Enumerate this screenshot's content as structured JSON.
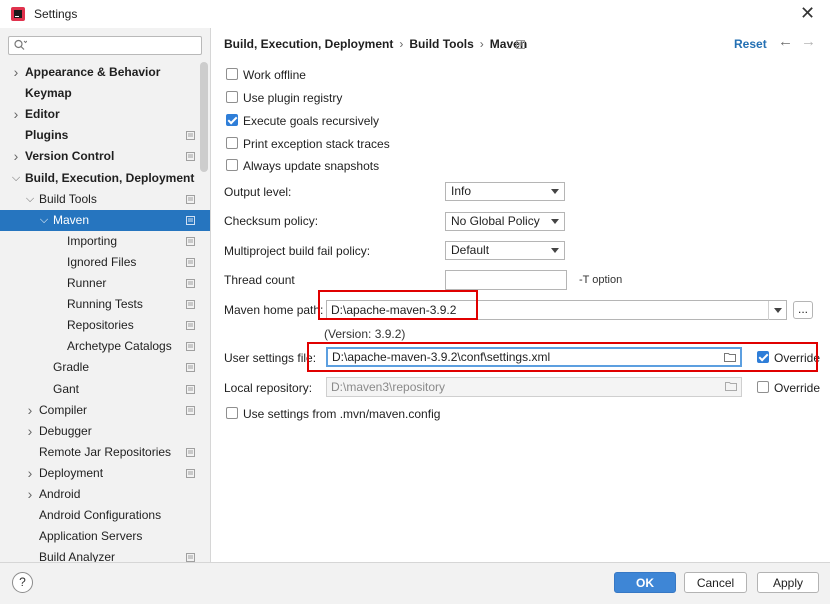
{
  "window": {
    "title": "Settings"
  },
  "search": {
    "placeholder": ""
  },
  "sidebar": {
    "items": [
      {
        "label": "Appearance & Behavior",
        "arrow": ">",
        "bold": true
      },
      {
        "label": "Keymap",
        "arrow": "",
        "bold": true
      },
      {
        "label": "Editor",
        "arrow": ">",
        "bold": true
      },
      {
        "label": "Plugins",
        "arrow": "",
        "bold": true
      },
      {
        "label": "Version Control",
        "arrow": ">",
        "bold": true
      },
      {
        "label": "Build, Execution, Deployment",
        "arrow": "v",
        "bold": true
      },
      {
        "label": "Build Tools",
        "arrow": "v"
      },
      {
        "label": "Maven",
        "arrow": "v",
        "selected": true
      },
      {
        "label": "Importing"
      },
      {
        "label": "Ignored Files"
      },
      {
        "label": "Runner"
      },
      {
        "label": "Running Tests"
      },
      {
        "label": "Repositories"
      },
      {
        "label": "Archetype Catalogs"
      },
      {
        "label": "Gradle"
      },
      {
        "label": "Gant"
      },
      {
        "label": "Compiler",
        "arrow": ">"
      },
      {
        "label": "Debugger",
        "arrow": ">"
      },
      {
        "label": "Remote Jar Repositories"
      },
      {
        "label": "Deployment",
        "arrow": ">"
      },
      {
        "label": "Android",
        "arrow": ">"
      },
      {
        "label": "Android Configurations"
      },
      {
        "label": "Application Servers"
      },
      {
        "label": "Build Analyzer"
      }
    ]
  },
  "breadcrumb": {
    "part1": "Build, Execution, Deployment",
    "sep": "›",
    "part2": "Build Tools",
    "part3": "Maven"
  },
  "header": {
    "reset": "Reset",
    "back": "←",
    "forward": "→"
  },
  "checkboxes": {
    "work_offline": {
      "label": "Work offline",
      "checked": false
    },
    "plugin_registry": {
      "label": "Use plugin registry",
      "checked": false
    },
    "execute_recursive": {
      "label": "Execute goals recursively",
      "checked": true
    },
    "print_stack": {
      "label": "Print exception stack traces",
      "checked": false
    },
    "update_snapshots": {
      "label": "Always update snapshots",
      "checked": false
    },
    "mvn_config": {
      "label": "Use settings from .mvn/maven.config",
      "checked": false
    }
  },
  "form": {
    "output_level": {
      "label": "Output level:",
      "value": "Info"
    },
    "checksum_policy": {
      "label": "Checksum policy:",
      "value": "No Global Policy"
    },
    "fail_policy": {
      "label": "Multiproject build fail policy:",
      "value": "Default"
    },
    "thread_count": {
      "label": "Thread count",
      "value": "",
      "hint": "-T option"
    },
    "maven_home": {
      "label": "Maven home path:",
      "value": "D:\\apache-maven-3.9.2",
      "version": "(Version: 3.9.2)",
      "browse": "..."
    },
    "user_settings": {
      "label": "User settings file:",
      "value": "D:\\apache-maven-3.9.2\\conf\\settings.xml",
      "override": "Override",
      "override_checked": true
    },
    "local_repo": {
      "label": "Local repository:",
      "value": "D:\\maven3\\repository",
      "override": "Override",
      "override_checked": false
    }
  },
  "footer": {
    "help": "?",
    "ok": "OK",
    "cancel": "Cancel",
    "apply": "Apply"
  },
  "colors": {
    "accent": "#2675bf",
    "highlight": "#e00000",
    "primary_button": "#3e86d6"
  }
}
